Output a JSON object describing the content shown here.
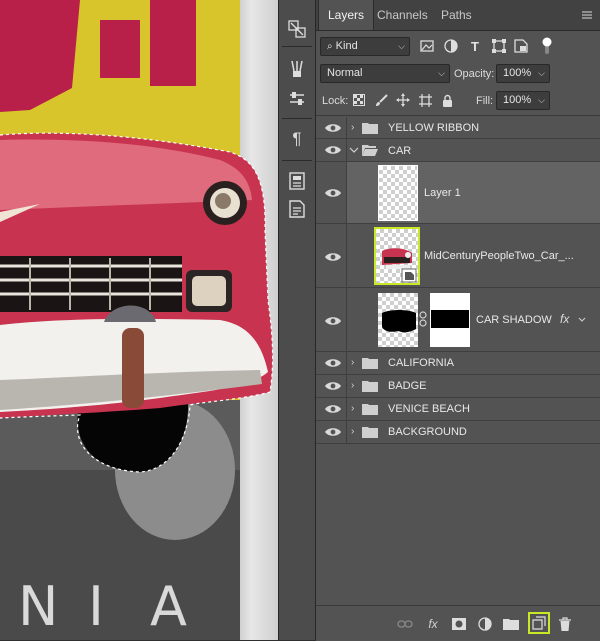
{
  "canvas": {
    "poster_letters": [
      "N",
      "I",
      "A"
    ]
  },
  "toolstrip": {
    "icons": [
      "swap-panels-icon",
      "brush-settings-icon",
      "adjustments-icon",
      "paragraph-icon",
      "glyphs-icon",
      "notes-icon"
    ],
    "paragraph_glyph": "¶"
  },
  "panel": {
    "tabs": [
      "Layers",
      "Channels",
      "Paths"
    ],
    "filter_kind": "Kind",
    "blend_mode": "Normal",
    "opacity_label": "Opacity:",
    "opacity_value": "100%",
    "lock_label": "Lock:",
    "fill_label": "Fill:",
    "fill_value": "100%",
    "layers": {
      "yellow_ribbon": "YELLOW RIBBON",
      "car": "CAR",
      "layer1": "Layer 1",
      "midcentury": "MidCenturyPeopleTwo_Car_...",
      "car_shadow": "CAR SHADOW",
      "california": "CALIFORNIA",
      "badge": "BADGE",
      "venice_beach": "VENICE BEACH",
      "background": "BACKGROUND"
    },
    "fx_label": "fx",
    "highlight_color": "#c8ea26"
  }
}
